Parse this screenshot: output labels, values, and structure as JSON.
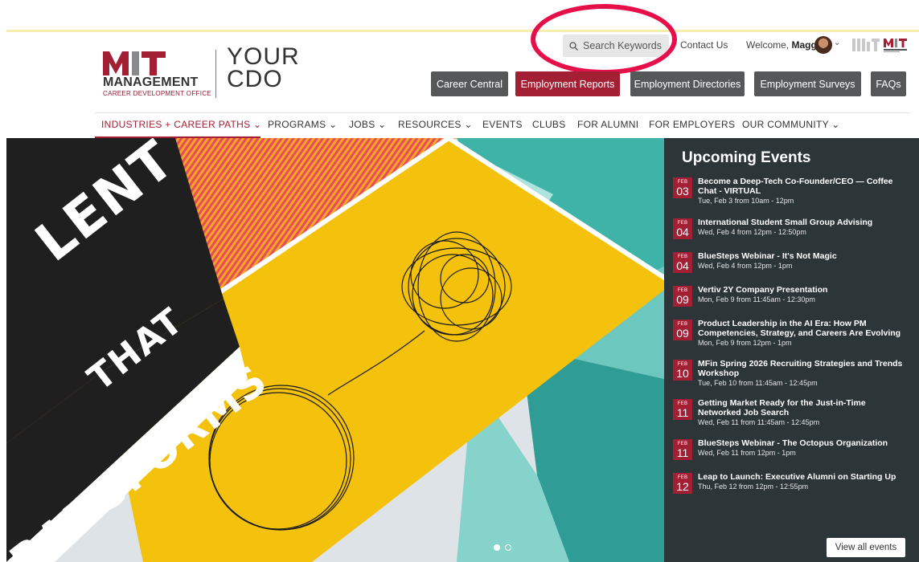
{
  "brand": {
    "logo_letters": "MIT",
    "management": "MANAGEMENT",
    "office": "CAREER DEVELOPMENT OFFICE",
    "your": "YOUR",
    "cdo": "CDO",
    "accent_color": "#a31f34"
  },
  "utility": {
    "search_placeholder": "Search Keywords",
    "contact": "Contact Us",
    "welcome_prefix": "Welcome, ",
    "user_name": "Maggie"
  },
  "buttons": [
    {
      "label": "Career Central"
    },
    {
      "label": "Employment Reports"
    },
    {
      "label": "Employment Directories"
    },
    {
      "label": "Employment Surveys"
    },
    {
      "label": "FAQs"
    }
  ],
  "nav": [
    {
      "label": "INDUSTRIES + CAREER PATHS ⌄"
    },
    {
      "label": "PROGRAMS ⌄"
    },
    {
      "label": "JOBS ⌄"
    },
    {
      "label": "RESOURCES ⌄"
    },
    {
      "label": "EVENTS"
    },
    {
      "label": "CLUBS"
    },
    {
      "label": "FOR ALUMNI"
    },
    {
      "label": "FOR EMPLOYERS"
    },
    {
      "label": "OUR COMMUNITY ⌄"
    }
  ],
  "hero": {
    "line1": "LENT",
    "line2": "THAT",
    "line3": "RANSFORMS",
    "slides_total": 2,
    "slide_active": 1
  },
  "events": {
    "title": "Upcoming Events",
    "view_all": "View all events",
    "items": [
      {
        "month": "FEB",
        "day": "03",
        "title": "Become a Deep-Tech Co-Founder/CEO — Coffee Chat - VIRTUAL",
        "time": "Tue, Feb 3 from 10am - 12pm"
      },
      {
        "month": "FEB",
        "day": "04",
        "title": "International Student Small Group Advising",
        "time": "Wed, Feb 4 from 12pm - 12:50pm"
      },
      {
        "month": "FEB",
        "day": "04",
        "title": "BlueSteps Webinar - It's Not Magic",
        "time": "Wed, Feb 4 from 12pm - 1pm"
      },
      {
        "month": "FEB",
        "day": "09",
        "title": "Vertiv 2Y Company Presentation",
        "time": "Mon, Feb 9 from 11:45am - 12:30pm"
      },
      {
        "month": "FEB",
        "day": "09",
        "title": "Product Leadership in the AI Era: How PM Competencies, Strategy, and Careers Are Evolving",
        "time": "Mon, Feb 9 from 12pm - 1pm"
      },
      {
        "month": "FEB",
        "day": "10",
        "title": "MFin Spring 2026 Recruiting Strategies and Trends Workshop",
        "time": "Tue, Feb 10 from 11:45am - 12:45pm"
      },
      {
        "month": "FEB",
        "day": "11",
        "title": "Getting Market Ready for the Just-in-Time Networked Job Search",
        "time": "Wed, Feb 11 from 11:45am - 12:45pm"
      },
      {
        "month": "FEB",
        "day": "11",
        "title": "BlueSteps Webinar - The Octopus Organization",
        "time": "Wed, Feb 11 from 12pm - 1pm"
      },
      {
        "month": "FEB",
        "day": "12",
        "title": "Leap to Launch: Executive Alumni on Starting Up",
        "time": "Thu, Feb 12 from 12pm - 12:55pm"
      }
    ]
  }
}
